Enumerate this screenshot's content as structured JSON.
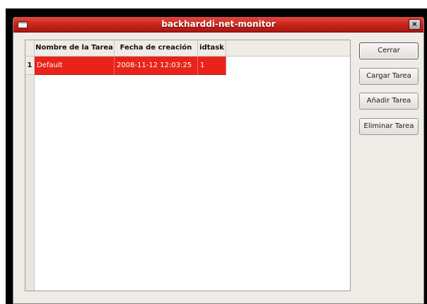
{
  "window": {
    "title": "backharddi-net-monitor",
    "close_glyph": "×",
    "menu_icon": "window-menu-icon"
  },
  "table": {
    "columns": [
      {
        "label": "Nombre de la Tarea"
      },
      {
        "label": "Fecha de creación"
      },
      {
        "label": "idtask"
      }
    ],
    "rows": [
      {
        "num": "1",
        "cells": [
          "Default",
          "2008-11-12 12:03:25",
          "1"
        ],
        "selected": true
      }
    ]
  },
  "buttons": {
    "close": "Cerrar",
    "load": "Cargar Tarea",
    "add": "Añadir Tarea",
    "delete": "Eliminar Tarea"
  },
  "colors": {
    "titlebar": "#c8251c",
    "selection": "#e8231a",
    "window_bg": "#efebe7"
  }
}
